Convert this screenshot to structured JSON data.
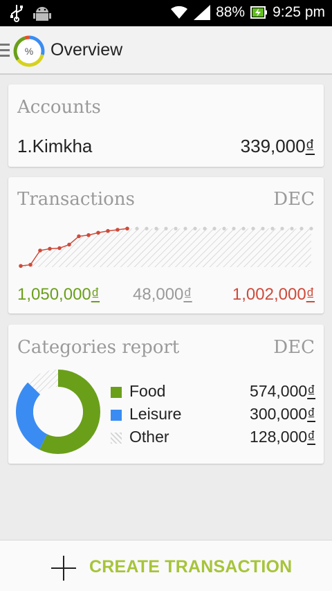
{
  "status_bar": {
    "battery": "88%",
    "time": "9:25 pm",
    "icons": [
      "usb-icon",
      "android-debug-icon",
      "wifi-icon",
      "signal-icon",
      "battery-charging-icon"
    ]
  },
  "app_bar": {
    "title": "Overview",
    "icons": [
      "menu-icon",
      "app-logo-icon"
    ],
    "logo_text": "%"
  },
  "accounts": {
    "title": "Accounts",
    "items": [
      {
        "name": "1.Kimkha",
        "amount": "339,000",
        "currency": "₫"
      }
    ]
  },
  "transactions": {
    "title": "Transactions",
    "month": "DEC",
    "income": "1,050,000",
    "net": "48,000",
    "expense": "1,002,000",
    "currency": "₫",
    "chart_data": {
      "type": "line",
      "x": [
        1,
        2,
        3,
        4,
        5,
        6,
        7,
        8,
        9,
        10,
        11,
        12,
        13,
        14,
        15,
        16,
        17,
        18,
        19,
        20,
        21,
        22,
        23,
        24,
        25,
        26,
        27,
        28,
        29,
        30,
        31
      ],
      "values": [
        2,
        4,
        28,
        31,
        32,
        38,
        52,
        54,
        58,
        61,
        63,
        65,
        null,
        null,
        null,
        null,
        null,
        null,
        null,
        null,
        null,
        null,
        null,
        null,
        null,
        null,
        null,
        null,
        null,
        null,
        null
      ],
      "future_markers": true,
      "colors": {
        "line": "#cf4a3a",
        "future": "#d0d0d0"
      }
    }
  },
  "categories": {
    "title": "Categories report",
    "month": "DEC",
    "currency": "₫",
    "items": [
      {
        "name": "Food",
        "value": "574,000",
        "color": "#6a9f1a"
      },
      {
        "name": "Leisure",
        "value": "300,000",
        "color": "#3a8cf2"
      },
      {
        "name": "Other",
        "value": "128,000",
        "color": "hatched"
      }
    ],
    "chart_data": {
      "type": "pie",
      "categories": [
        "Food",
        "Leisure",
        "Other"
      ],
      "values": [
        574000,
        300000,
        128000
      ]
    }
  },
  "bottom_action": {
    "label": "CREATE TRANSACTION",
    "icon": "plus-icon"
  }
}
